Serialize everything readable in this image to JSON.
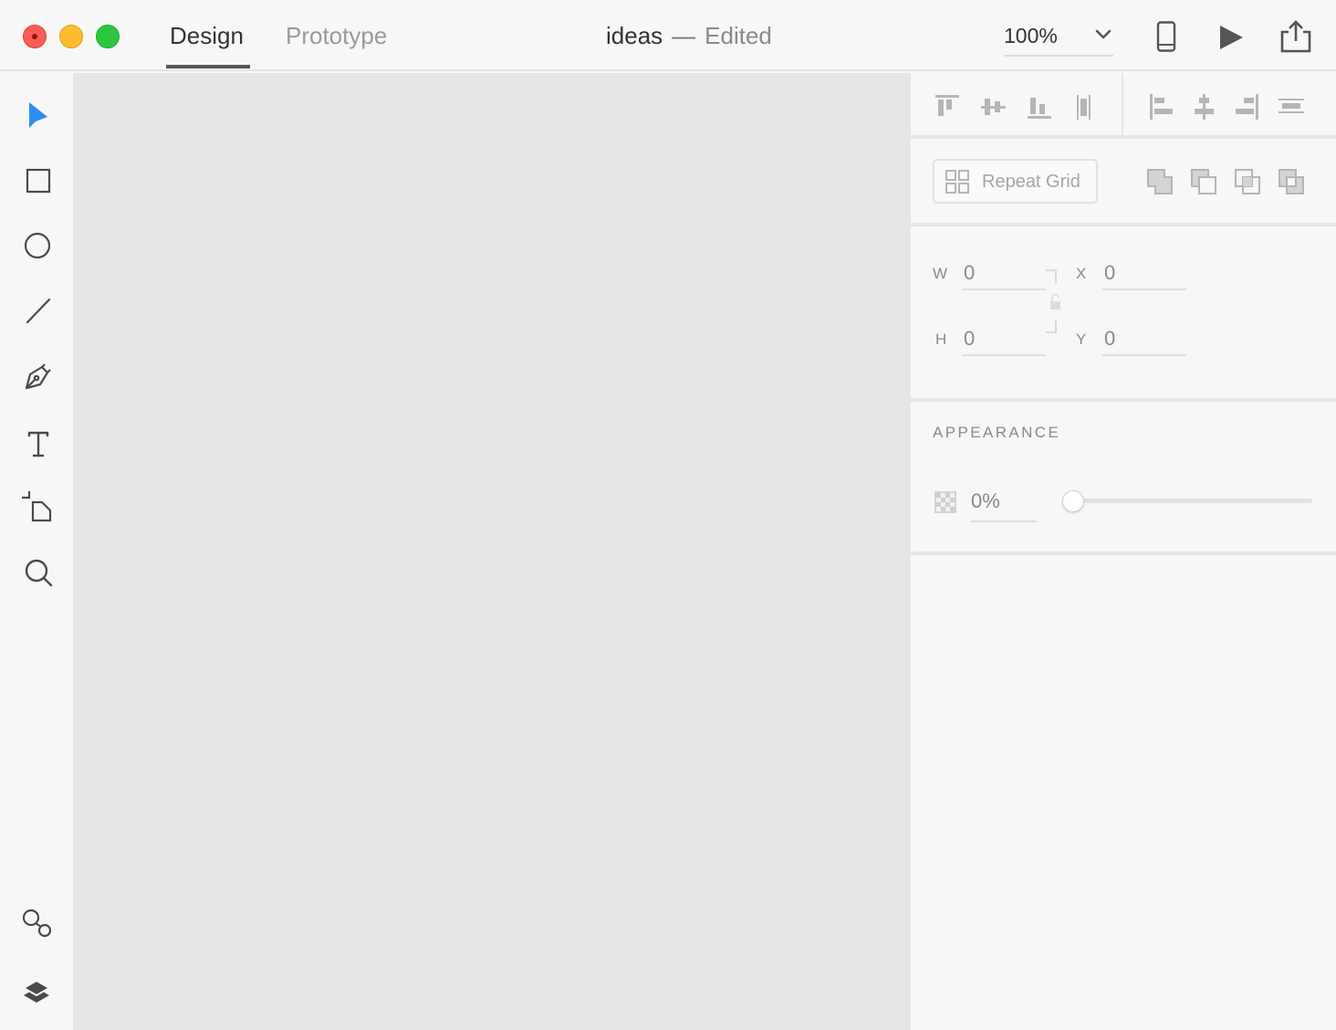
{
  "titlebar": {
    "tabs": [
      {
        "label": "Design",
        "active": true
      },
      {
        "label": "Prototype",
        "active": false
      }
    ],
    "doc_name": "ideas",
    "doc_separator": "—",
    "doc_status": "Edited",
    "zoom": "100%",
    "icons": [
      "device-preview-icon",
      "play-icon",
      "share-icon"
    ]
  },
  "tools": [
    {
      "name": "select-tool",
      "icon": "arrow-pointer-icon",
      "active": true
    },
    {
      "name": "rectangle-tool",
      "icon": "rectangle-icon"
    },
    {
      "name": "ellipse-tool",
      "icon": "ellipse-icon"
    },
    {
      "name": "line-tool",
      "icon": "line-icon"
    },
    {
      "name": "pen-tool",
      "icon": "pen-icon"
    },
    {
      "name": "text-tool",
      "icon": "text-icon"
    },
    {
      "name": "artboard-tool",
      "icon": "artboard-icon"
    },
    {
      "name": "zoom-tool",
      "icon": "magnifier-icon"
    }
  ],
  "bottom_tools": [
    "symbols-icon",
    "layers-icon"
  ],
  "panel": {
    "align_buttons": [
      "align-top-icon",
      "align-middle-icon",
      "align-bottom-icon",
      "distribute-horizontal-icon",
      "align-left-icon",
      "align-center-icon",
      "align-right-icon",
      "distribute-vertical-icon"
    ],
    "repeat_grid_label": "Repeat Grid",
    "boolean_buttons": [
      "add-icon",
      "subtract-icon",
      "intersect-icon",
      "exclude-icon"
    ],
    "dimensions": {
      "w_label": "W",
      "w_value": "0",
      "h_label": "H",
      "h_value": "0",
      "x_label": "X",
      "x_value": "0",
      "y_label": "Y",
      "y_value": "0"
    },
    "appearance": {
      "title": "APPEARANCE",
      "opacity": "0%",
      "opacity_level": 0
    }
  },
  "colors": {
    "accent": "#2c8ef0",
    "canvas": "#e5e5e5",
    "chrome": "#f7f7f7",
    "icon_gray": "#b5b5b5"
  }
}
